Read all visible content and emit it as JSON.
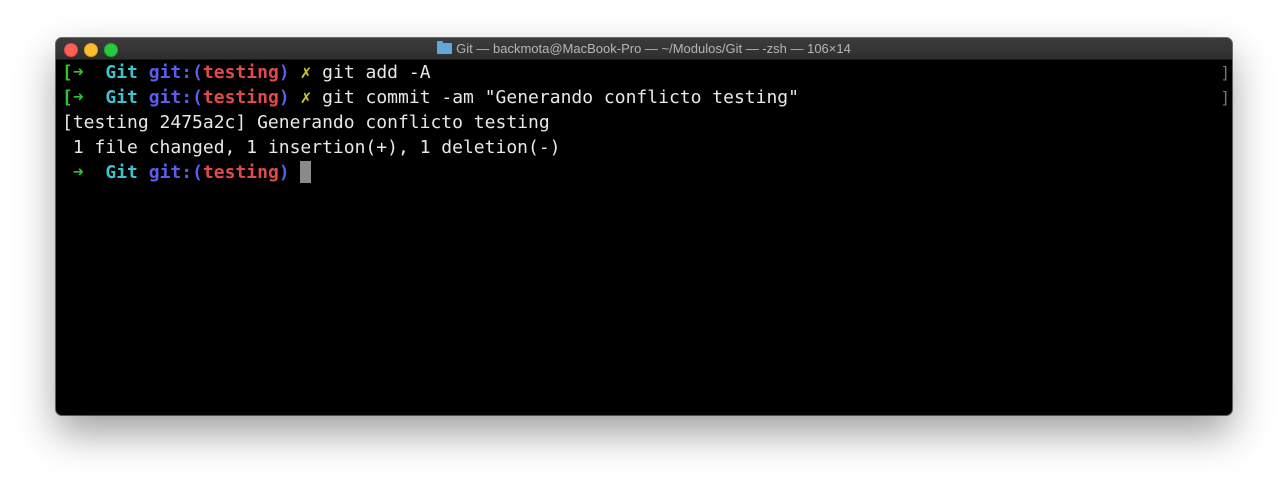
{
  "window": {
    "title": "Git — backmota@MacBook-Pro — ~/Modulos/Git — -zsh — 106×14",
    "folder_icon": "folder-icon"
  },
  "prompt": {
    "arrow": "➜",
    "dir": "Git",
    "git_label": "git:(",
    "branch": "testing",
    "git_close": ")",
    "dirty": "✗"
  },
  "lines": [
    {
      "type": "prompt",
      "command": "git add -A",
      "marker_left": "[",
      "marker_right": "]"
    },
    {
      "type": "prompt",
      "command": "git commit -am \"Generando conflicto testing\"",
      "marker_left": "[",
      "marker_right": "]"
    },
    {
      "type": "output",
      "text": "[testing 2475a2c] Generando conflicto testing"
    },
    {
      "type": "output",
      "text": " 1 file changed, 1 insertion(+), 1 deletion(-)"
    },
    {
      "type": "prompt-current",
      "command": ""
    }
  ],
  "colors": {
    "background": "#000000",
    "arrow": "#2fc42f",
    "dir": "#3fc1cf",
    "git_label": "#5c5cf0",
    "branch": "#e04a4a",
    "dirty": "#c9c93a",
    "text": "#e8e8e8"
  }
}
